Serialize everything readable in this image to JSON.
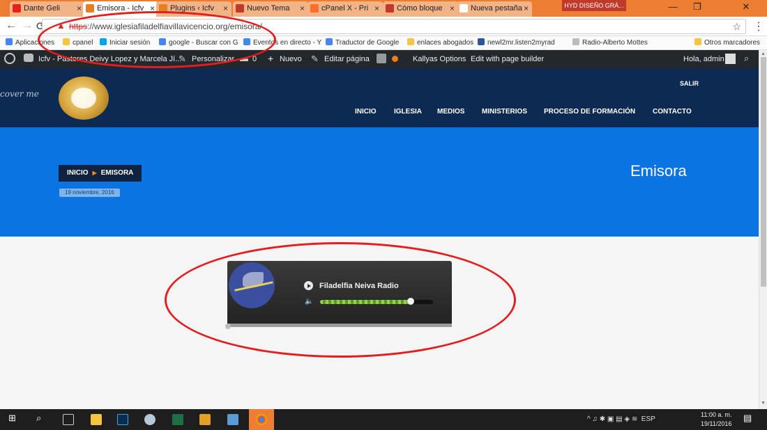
{
  "browser": {
    "tabs": [
      {
        "title": "Dante Geli",
        "active": false,
        "favicon_color": "#e62117"
      },
      {
        "title": "Emisora - Icfv",
        "active": true,
        "favicon_color": "#e67e22"
      },
      {
        "title": "Plugins ‹ Icfv",
        "active": false,
        "favicon_color": "#e67e22"
      },
      {
        "title": "Nuevo Tema",
        "active": false,
        "favicon_color": "#c0392b"
      },
      {
        "title": "cPanel X - Pri",
        "active": false,
        "favicon_color": "#ff6c2c"
      },
      {
        "title": "Cómo bloque",
        "active": false,
        "favicon_color": "#c0392b"
      },
      {
        "title": "Nueva pestaña",
        "active": false,
        "favicon_color": "#ffffff"
      }
    ],
    "user_badge": "HYD DISEÑO GRÁ...",
    "window_controls": {
      "minimize": "—",
      "restore": "❐",
      "close": "✕"
    },
    "nav": {
      "back": "←",
      "forward": "→",
      "reload": "⟳"
    },
    "url": {
      "scheme": "https",
      "rest": "://www.iglesiafiladelfiavillavicencio.org/emisora/"
    },
    "star": "☆",
    "menu": "⋮"
  },
  "bookmarks": [
    {
      "label": "Aplicaciones",
      "icon": "apps-icon",
      "color": "#4285f4"
    },
    {
      "label": "cpanel",
      "icon": "folder-icon",
      "color": "#f5c542"
    },
    {
      "label": "Iniciar sesión",
      "icon": "windows-icon",
      "color": "#00a4ef"
    },
    {
      "label": "google - Buscar con G",
      "icon": "google-icon",
      "color": "#4285f4"
    },
    {
      "label": "Eventos en directo - Y",
      "icon": "google-icon",
      "color": "#4285f4"
    },
    {
      "label": "Traductor de Google",
      "icon": "translate-icon",
      "color": "#4285f4"
    },
    {
      "label": "enlaces abogados",
      "icon": "folder-icon",
      "color": "#f5c542"
    },
    {
      "label": "newl2mr.listen2myrad",
      "icon": "radio-icon",
      "color": "#2b5797"
    },
    {
      "label": "Radio-Alberto Mottes",
      "icon": "page-icon",
      "color": "#bbbbbb"
    },
    {
      "label": "Otros marcadores",
      "icon": "folder-icon",
      "color": "#f5c542"
    }
  ],
  "wp_admin": {
    "site": "Icfv - Pastores Deivy Lopez y Marcela Jí...",
    "customize": "Personalizar",
    "comments": "0",
    "new": "Nuevo",
    "edit": "Editar página",
    "kallyas": "Kallyas Options",
    "builder": "Edit with page builder",
    "greeting": "Hola, admin"
  },
  "site": {
    "cover_text": "cover me",
    "logout": "SALIR",
    "menu": [
      "INICIO",
      "IGLESIA",
      "MEDIOS",
      "MINISTERIOS",
      "PROCESO DE FORMACIÓN",
      "CONTACTO"
    ],
    "breadcrumb": {
      "home": "INICIO",
      "current": "EMISORA"
    },
    "date": "19 noviembre, 2016",
    "title": "Emisora"
  },
  "player": {
    "station": "Filadelfia Neiva Radio",
    "volume": 0.8
  },
  "taskbar": {
    "tray": "^ ♫ ✱ ▣ ▤ ◈ ≋",
    "lang": "ESP",
    "time": "11:00 a. m.",
    "date": "19/11/2016"
  }
}
